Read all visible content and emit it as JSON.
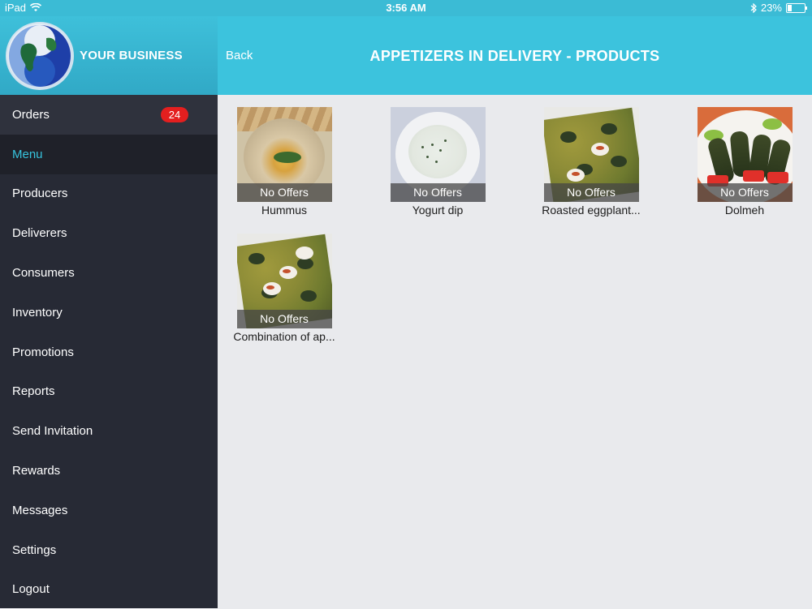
{
  "status_bar": {
    "device": "iPad",
    "time": "3:56 AM",
    "battery": "23%",
    "battery_level": 0.23
  },
  "sidebar": {
    "brand": "YOUR BUSINESS",
    "items": [
      {
        "label": "Orders",
        "badge": "24"
      },
      {
        "label": "Menu"
      },
      {
        "label": "Producers"
      },
      {
        "label": "Deliverers"
      },
      {
        "label": "Consumers"
      },
      {
        "label": "Inventory"
      },
      {
        "label": "Promotions"
      },
      {
        "label": "Reports"
      },
      {
        "label": "Send Invitation"
      },
      {
        "label": "Rewards"
      },
      {
        "label": "Messages"
      },
      {
        "label": "Settings"
      },
      {
        "label": "Logout"
      }
    ],
    "active_item": "Menu"
  },
  "header": {
    "back_label": "Back",
    "title": "APPETIZERS IN DELIVERY - PRODUCTS"
  },
  "products": [
    {
      "name": "Hummus",
      "offer": "No Offers"
    },
    {
      "name": "Yogurt dip",
      "offer": "No Offers"
    },
    {
      "name": "Roasted eggplant...",
      "offer": "No Offers"
    },
    {
      "name": "Dolmeh",
      "offer": "No Offers"
    },
    {
      "name": "Combination of ap...",
      "offer": "No Offers"
    }
  ],
  "colors": {
    "accent": "#3cc3dd",
    "sidebar_bg": "#272a35",
    "badge": "#e41f1f",
    "content_bg": "#e9eaed"
  }
}
